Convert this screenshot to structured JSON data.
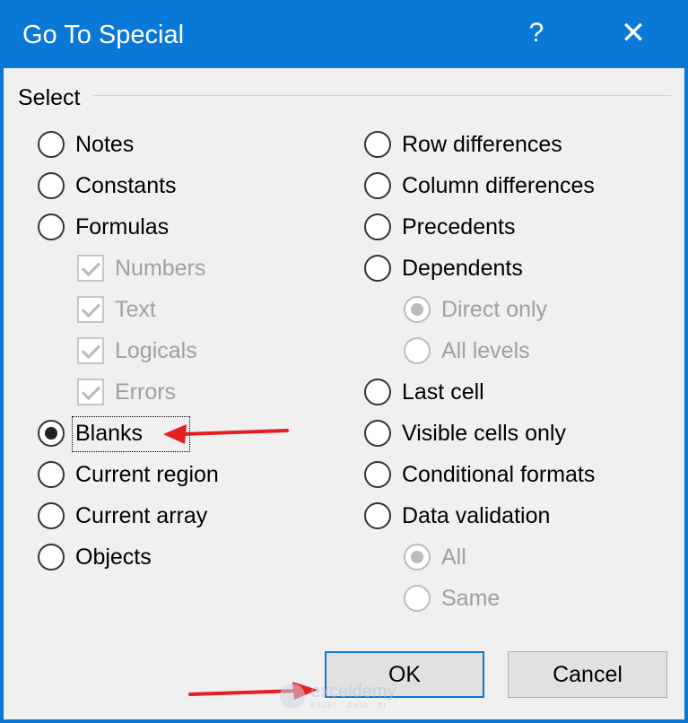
{
  "dialog": {
    "title": "Go To Special",
    "help": "?",
    "close": "✕"
  },
  "group": {
    "title": "Select"
  },
  "left": {
    "notes": "Notes",
    "constants": "Constants",
    "formulas": "Formulas",
    "numbers": "Numbers",
    "text": "Text",
    "logicals": "Logicals",
    "errors": "Errors",
    "blanks": "Blanks",
    "current_region": "Current region",
    "current_array": "Current array",
    "objects": "Objects"
  },
  "right": {
    "row_differences": "Row differences",
    "column_differences": "Column differences",
    "precedents": "Precedents",
    "dependents": "Dependents",
    "direct_only": "Direct only",
    "all_levels": "All levels",
    "last_cell": "Last cell",
    "visible_cells_only": "Visible cells only",
    "conditional_formats": "Conditional formats",
    "data_validation": "Data validation",
    "all": "All",
    "same": "Same"
  },
  "selected_option": "Blanks",
  "buttons": {
    "ok": "OK",
    "cancel": "Cancel"
  },
  "watermark": {
    "name": "exceldemy",
    "tagline": "EXCEL · DATA · BI"
  },
  "colors": {
    "titlebar": "#0a78d7",
    "annotation_arrow": "#e31e24"
  }
}
